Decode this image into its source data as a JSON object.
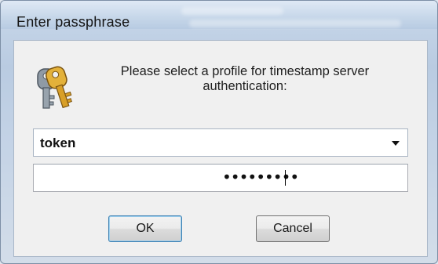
{
  "window": {
    "title": "Enter passphrase"
  },
  "dialog": {
    "message": "Please select a profile for timestamp server authentication:",
    "icon": "keys-icon"
  },
  "profile_select": {
    "selected_value": "token",
    "arrow_icon": "dropdown-arrow-icon"
  },
  "passphrase_field": {
    "masked_value": "•••••••••"
  },
  "buttons": {
    "ok_label": "OK",
    "cancel_label": "Cancel"
  },
  "colors": {
    "client_background": "#f0f0f0",
    "frame_blue": "#b9cbe1",
    "key_gold": "#d8a12a"
  }
}
